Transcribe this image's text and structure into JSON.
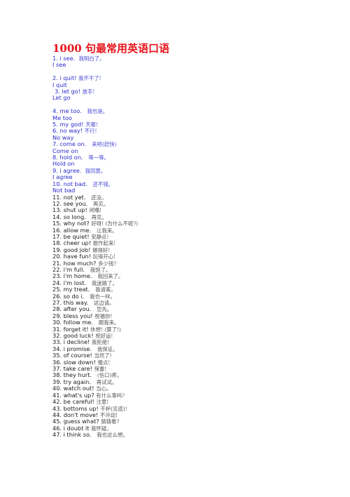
{
  "document": {
    "title": "1000 句最常用英语口语",
    "blue_entries": [
      {
        "en": "1. i see.",
        "zh": "我明白了。",
        "gloss": "I see"
      },
      {
        "en": "2. i quit!",
        "zh": "我不干了!",
        "gloss": "I quit"
      },
      {
        "en": "3. let go!",
        "zh": "放手!",
        "gloss": "Let go"
      },
      {
        "en": "4. me too.",
        "zh": "我也是。",
        "gloss": "Me too"
      },
      {
        "en": "5. my god!",
        "zh": "天哪!",
        "gloss": ""
      },
      {
        "en": "6. no way!",
        "zh": "不行!",
        "gloss": "No way"
      },
      {
        "en": "7. come on.",
        "zh": "来吧(赶快)",
        "gloss": "Come on"
      },
      {
        "en": "8. hold on.",
        "zh": "等一等。",
        "gloss": "Hold on"
      },
      {
        "en": "9. i agree.",
        "zh": "我同意。",
        "gloss": "I agree"
      },
      {
        "en": "10. not bad.",
        "zh": "还不错。",
        "gloss": "Not bad"
      }
    ],
    "entries": [
      {
        "en": "11. not yet.",
        "zh": "还没。"
      },
      {
        "en": "12. see you.",
        "zh": "再见。"
      },
      {
        "en": "13. shut up!",
        "zh": "闭嘴!"
      },
      {
        "en": "14. so long.",
        "zh": "再见。"
      },
      {
        "en": "15. why not?",
        "zh": "好呀! (为什么不呢?)"
      },
      {
        "en": "16. allow me.",
        "zh": "让我来。"
      },
      {
        "en": "17. be quiet!",
        "zh": "安静点!"
      },
      {
        "en": "18. cheer up!",
        "zh": "振作起来!"
      },
      {
        "en": "19. good job!",
        "zh": "做得好!"
      },
      {
        "en": "20. have fun!",
        "zh": "玩得开心!"
      },
      {
        "en": "21. how much?",
        "zh": "多少钱?"
      },
      {
        "en": "22. i'm full.",
        "zh": "我饱了。"
      },
      {
        "en": "23. i'm home.",
        "zh": "我回来了。"
      },
      {
        "en": "24. i'm lost.",
        "zh": "我迷路了。"
      },
      {
        "en": "25. my treat.",
        "zh": "我请客。"
      },
      {
        "en": "26. so do i.",
        "zh": "我也一样。"
      },
      {
        "en": "27. this way.",
        "zh": "这边请。"
      },
      {
        "en": "28. after you.",
        "zh": "您先。"
      },
      {
        "en": "29. bless you!",
        "zh": "祝福你!"
      },
      {
        "en": "30. follow me.",
        "zh": "跟我来。"
      },
      {
        "en": "31. forget it!",
        "zh": "休想! (算了!)"
      },
      {
        "en": "32. good luck!",
        "zh": "祝好运!"
      },
      {
        "en": "33. i decline!",
        "zh": "我拒绝!"
      },
      {
        "en": "34. i promise.",
        "zh": "我保证。"
      },
      {
        "en": "35. of course!",
        "zh": "当然了!"
      },
      {
        "en": "36. slow down!",
        "zh": "慢点!"
      },
      {
        "en": "37. take care!",
        "zh": "保重!"
      },
      {
        "en": "38. they hurt.",
        "zh": "(伤口)疼。"
      },
      {
        "en": "39. try again.",
        "zh": "再试试。"
      },
      {
        "en": "40. watch out!",
        "zh": "当心。"
      },
      {
        "en": "41. what's up?",
        "zh": "有什么事吗?"
      },
      {
        "en": "42. be careful!",
        "zh": "注意!"
      },
      {
        "en": "43. bottoms up!",
        "zh": "干杯(见底)!"
      },
      {
        "en": "44. don't move!",
        "zh": "不许动!"
      },
      {
        "en": "45. guess what?",
        "zh": "猜猜看?"
      },
      {
        "en": "46. i doubt it",
        "zh": "我怀疑。"
      },
      {
        "en": "47. i think so.",
        "zh": "我也这么想。"
      }
    ]
  },
  "colors": {
    "title": "#e8141c",
    "blue_text": "#2b2bcf",
    "black_text": "#1a1a1a"
  }
}
